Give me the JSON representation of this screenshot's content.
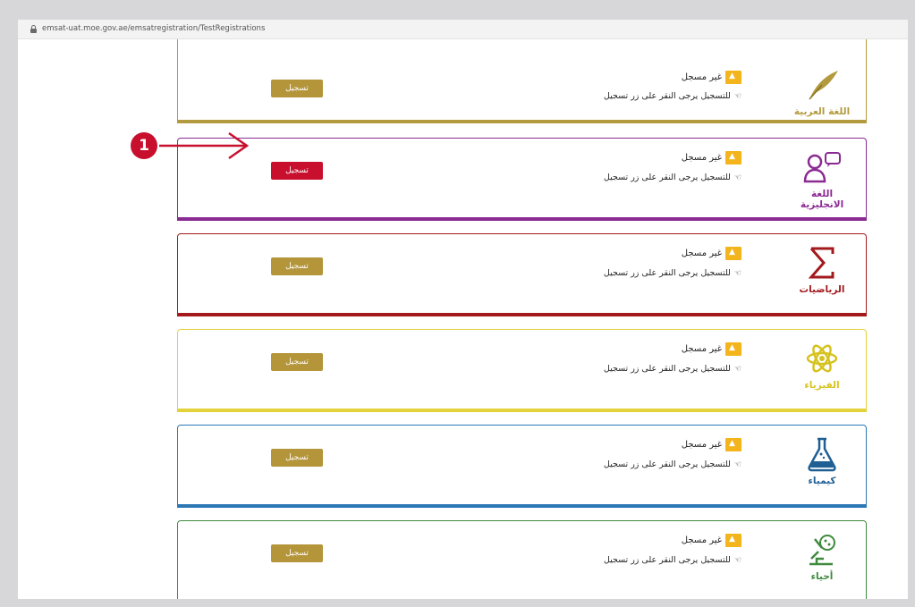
{
  "browser": {
    "url": "emsat-uat.moe.gov.ae/emsatregistration/TestRegistrations"
  },
  "callout": {
    "number": "1"
  },
  "colors": {
    "arabic": "#b49a3e",
    "english": "#8a2a92",
    "math": "#a31a1d",
    "physics": "#e3d23a",
    "chemistry": "#2c78b5",
    "biology": "#3f8a3e",
    "button_default": "#b4953a",
    "button_active": "#c8102e",
    "warning": "#f3b41c"
  },
  "cards": [
    {
      "subject": "اللغة العربية",
      "icon": "quill-icon",
      "status": "غير مسجل",
      "hint": "للتسجيل يرجى النقر على زر تسجيل",
      "button": "تسجيل",
      "active": false
    },
    {
      "subject": "اللغة الانجليزية",
      "icon": "speaker-hello-icon",
      "status": "غير مسجل",
      "hint": "للتسجيل يرجى النقر على زر تسجيل",
      "button": "تسجيل",
      "active": true
    },
    {
      "subject": "الرياضيات",
      "icon": "sigma-icon",
      "status": "غير مسجل",
      "hint": "للتسجيل يرجى النقر على زر تسجيل",
      "button": "تسجيل",
      "active": false
    },
    {
      "subject": "الفيزياء",
      "icon": "atom-icon",
      "status": "غير مسجل",
      "hint": "للتسجيل يرجى النقر على زر تسجيل",
      "button": "تسجيل",
      "active": false
    },
    {
      "subject": "كيمياء",
      "icon": "flask-icon",
      "status": "غير مسجل",
      "hint": "للتسجيل يرجى النقر على زر تسجيل",
      "button": "تسجيل",
      "active": false
    },
    {
      "subject": "أحياء",
      "icon": "microscope-icon",
      "status": "غير مسجل",
      "hint": "للتسجيل يرجى النقر على زر تسجيل",
      "button": "تسجيل",
      "active": false
    }
  ]
}
